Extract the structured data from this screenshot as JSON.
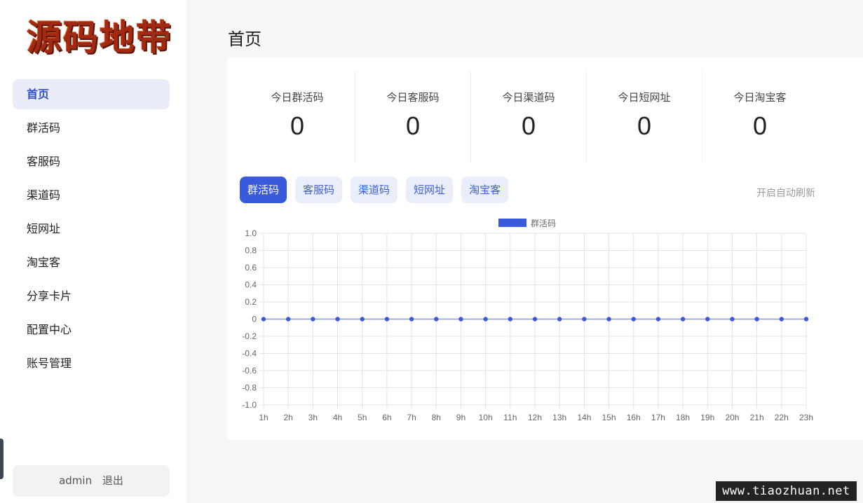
{
  "logo": {
    "text": "源码地带"
  },
  "sidebar": {
    "items": [
      {
        "label": "首页",
        "active": true
      },
      {
        "label": "群活码"
      },
      {
        "label": "客服码"
      },
      {
        "label": "渠道码"
      },
      {
        "label": "短网址"
      },
      {
        "label": "淘宝客"
      },
      {
        "label": "分享卡片"
      },
      {
        "label": "配置中心"
      },
      {
        "label": "账号管理"
      }
    ],
    "user": {
      "name": "admin",
      "logout_label": "退出"
    }
  },
  "page": {
    "title": "首页"
  },
  "stats": [
    {
      "label": "今日群活码",
      "value": "0"
    },
    {
      "label": "今日客服码",
      "value": "0"
    },
    {
      "label": "今日渠道码",
      "value": "0"
    },
    {
      "label": "今日短网址",
      "value": "0"
    },
    {
      "label": "今日淘宝客",
      "value": "0"
    }
  ],
  "tabs": [
    {
      "label": "群活码",
      "active": true
    },
    {
      "label": "客服码"
    },
    {
      "label": "渠道码"
    },
    {
      "label": "短网址"
    },
    {
      "label": "淘宝客"
    }
  ],
  "auto_refresh_label": "开启自动刷新",
  "chart_data": {
    "type": "line",
    "x": [
      "1h",
      "2h",
      "3h",
      "4h",
      "5h",
      "6h",
      "7h",
      "8h",
      "9h",
      "10h",
      "11h",
      "12h",
      "13h",
      "14h",
      "15h",
      "16h",
      "17h",
      "18h",
      "19h",
      "20h",
      "21h",
      "22h",
      "23h"
    ],
    "series": [
      {
        "name": "群活码",
        "color": "#3a5bd9",
        "values": [
          0,
          0,
          0,
          0,
          0,
          0,
          0,
          0,
          0,
          0,
          0,
          0,
          0,
          0,
          0,
          0,
          0,
          0,
          0,
          0,
          0,
          0,
          0
        ]
      }
    ],
    "ylim": [
      -1.0,
      1.0
    ],
    "yticks": [
      "1.0",
      "0.8",
      "0.6",
      "0.4",
      "0.2",
      "0",
      "-0.2",
      "-0.4",
      "-0.6",
      "-0.8",
      "-1.0"
    ],
    "grid": true,
    "legend": "top-center"
  },
  "watermark": "www.tiaozhuan.net",
  "colors": {
    "accent": "#3a5bd9",
    "accent_light": "#eaeefb",
    "background": "#f5f6f8"
  }
}
